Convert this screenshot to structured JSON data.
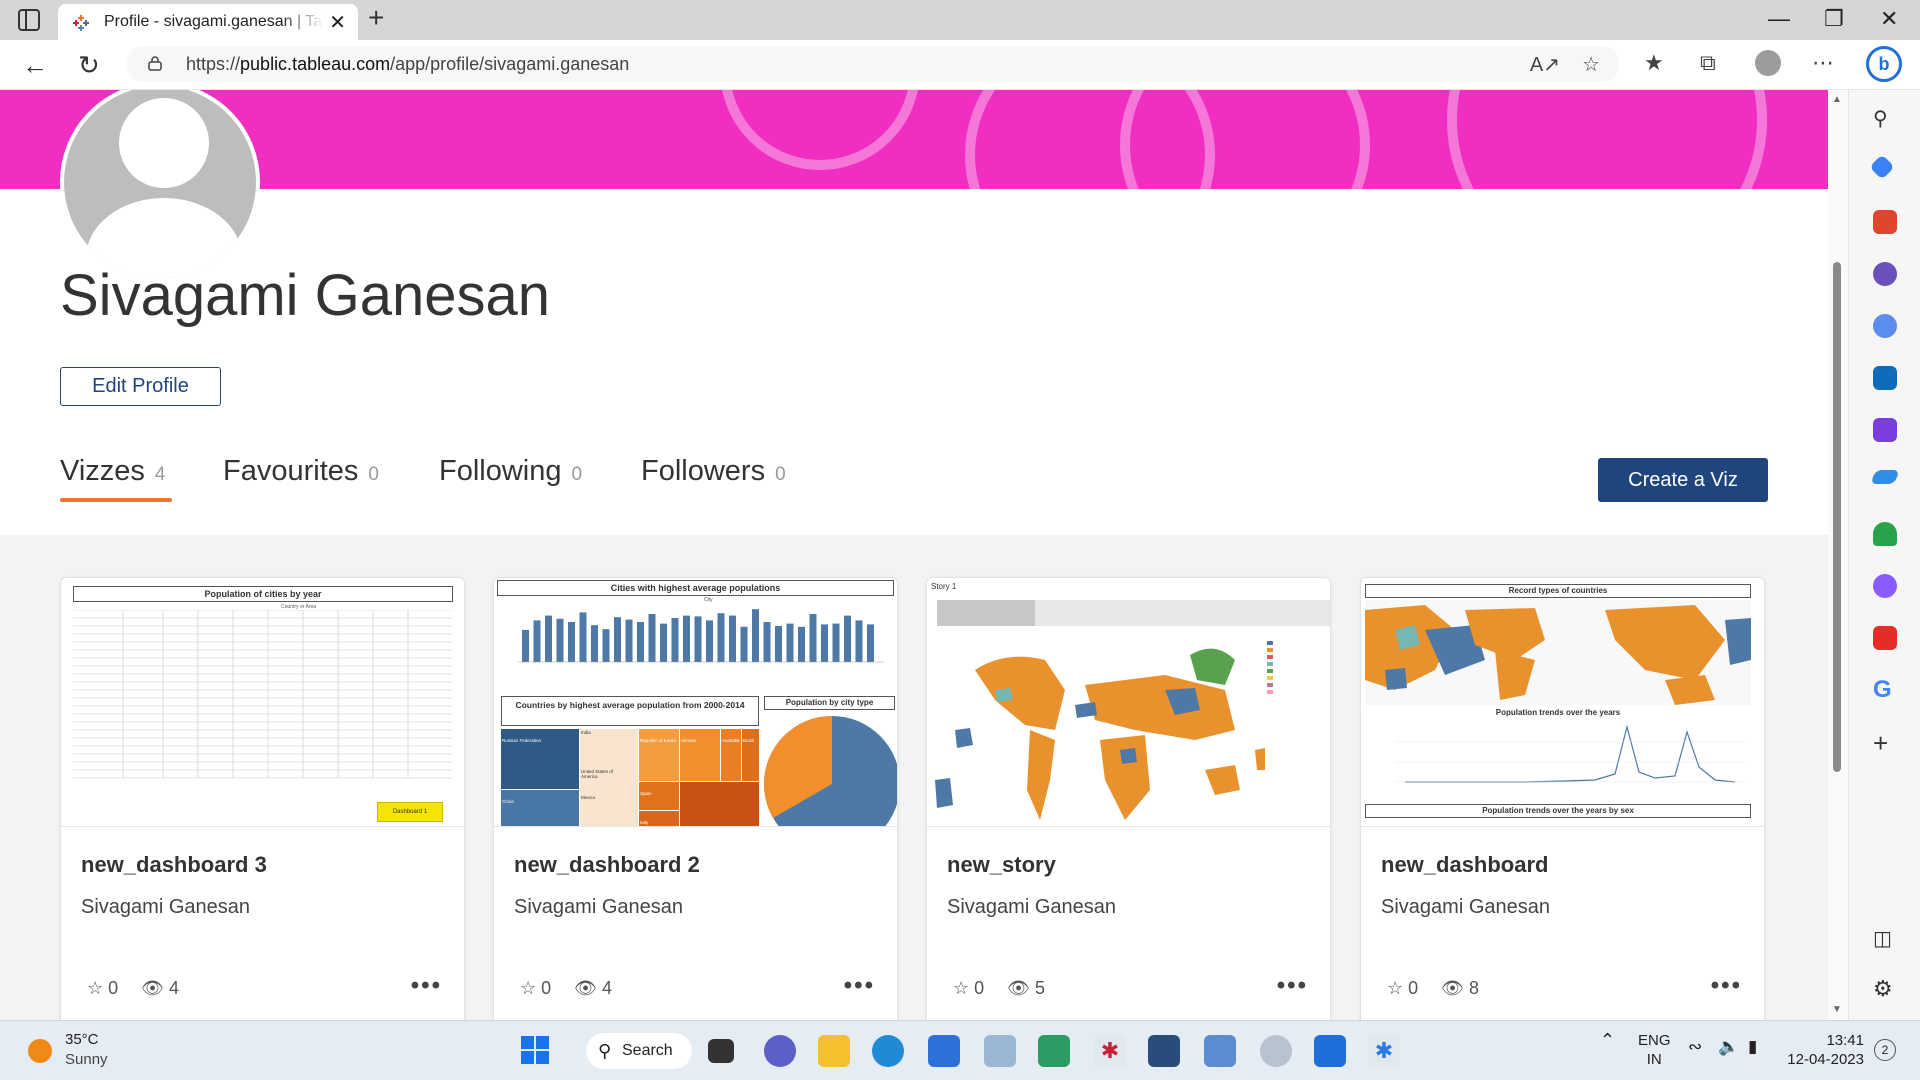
{
  "browser": {
    "tab_title": "Profile - sivagami.ganesan | Tableau Public",
    "url_prefix": "https://",
    "url_host": "public.tableau.com",
    "url_path": "/app/profile/sivagami.ganesan",
    "new_tab_glyph": "+",
    "close_glyph": "✕"
  },
  "profile": {
    "name": "Sivagami Ganesan",
    "edit_label": "Edit Profile",
    "create_label": "Create a Viz",
    "tabs": [
      {
        "label": "Vizzes",
        "count": "4"
      },
      {
        "label": "Favourites",
        "count": "0"
      },
      {
        "label": "Following",
        "count": "0"
      },
      {
        "label": "Followers",
        "count": "0"
      }
    ]
  },
  "cards": [
    {
      "title": "new_dashboard 3",
      "author": "Sivagami Ganesan",
      "favs": "0",
      "views": "4",
      "thumb_title": "Population of cities by year",
      "thumb_sub": "Country or Area",
      "thumb_button": "Dashboard 1"
    },
    {
      "title": "new_dashboard 2",
      "author": "Sivagami Ganesan",
      "favs": "0",
      "views": "4",
      "thumb_title": "Cities with highest average populations",
      "thumb_sub": "City",
      "thumb_title2": "Countries by highest average population from 2000-2014",
      "thumb_title3": "Population by city type",
      "tm_labels": [
        "Russian Federation",
        "India",
        "China",
        "United States of America",
        "Mexico",
        "Republic of Korea",
        "Ukraine",
        "Australia",
        "Brazil",
        "Spain",
        "Italy",
        "Indonesia"
      ]
    },
    {
      "title": "new_story",
      "author": "Sivagami Ganesan",
      "favs": "0",
      "views": "5",
      "thumb_title": "Story 1"
    },
    {
      "title": "new_dashboard",
      "author": "Sivagami Ganesan",
      "favs": "0",
      "views": "8",
      "thumb_title": "Record types of countries",
      "thumb_title2": "Population trends over the years",
      "thumb_title3": "Population trends over the years by sex"
    }
  ],
  "taskbar": {
    "temp": "35°C",
    "weather": "Sunny",
    "search_label": "Search",
    "lang1": "ENG",
    "lang2": "IN",
    "time": "13:41",
    "date": "12-04-2023",
    "notif": "2"
  },
  "colors": {
    "banner": "#f02fc2",
    "accent": "#e8762d",
    "primary": "#1f457e",
    "map_orange": "#e8912d",
    "map_blue": "#4e79a7"
  }
}
